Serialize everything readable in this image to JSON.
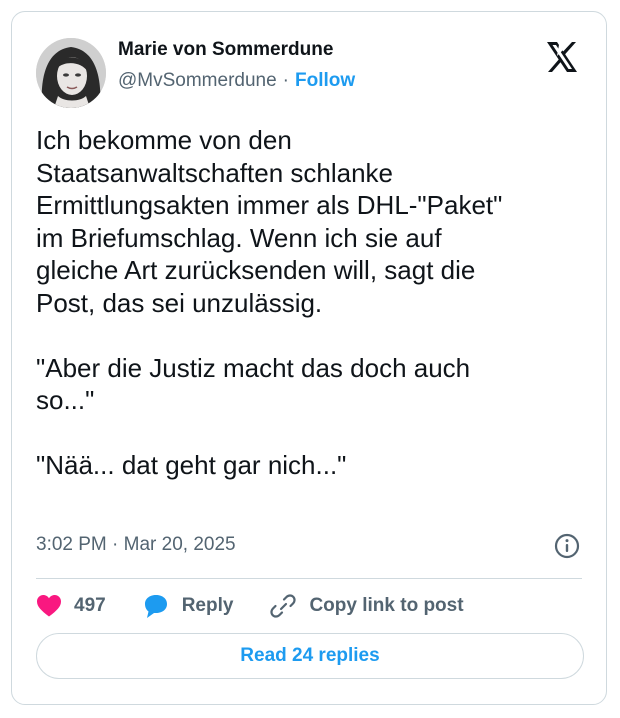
{
  "author": {
    "name": "Marie von Sommerdune",
    "handle": "@MvSommerdune",
    "separator": "·",
    "follow_label": "Follow"
  },
  "tweet": {
    "text": "Ich bekomme von den\nStaatsanwaltschaften schlanke\nErmittlungsakten immer als DHL-\"Paket\"\nim Briefumschlag. Wenn ich sie auf\ngleiche Art zurücksenden will, sagt die\nPost, das sei unzulässig.\n\n\"Aber die Justiz macht das doch auch\nso...\"\n\n\"Nää... dat geht gar nich...\"",
    "timestamp": "3:02 PM · Mar 20, 2025"
  },
  "actions": {
    "like_count": "497",
    "reply_label": "Reply",
    "copy_link_label": "Copy link to post"
  },
  "footer": {
    "read_replies_label": "Read 24 replies"
  },
  "icons": {
    "logo": "x-logo-icon",
    "info": "info-icon",
    "like": "heart-icon",
    "reply": "speech-bubble-icon",
    "copy_link": "link-icon"
  },
  "colors": {
    "accent": "#1d9bf0",
    "like": "#f91880",
    "text": "#0f1419",
    "secondary": "#536471",
    "border": "#cfd9de"
  }
}
